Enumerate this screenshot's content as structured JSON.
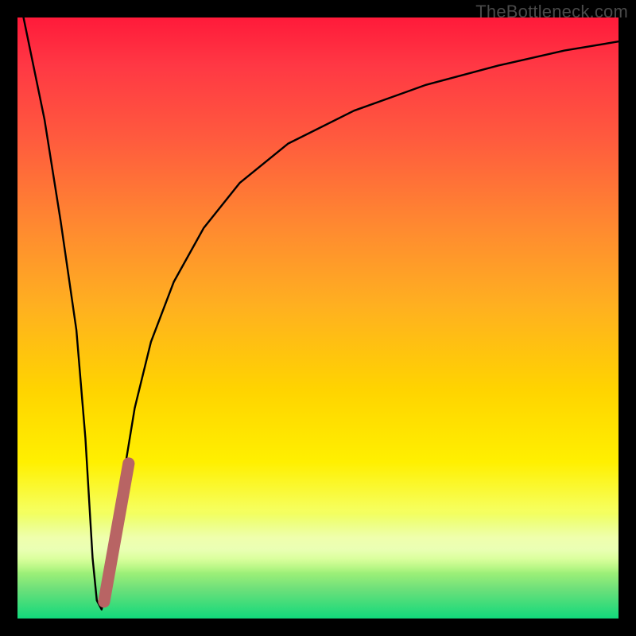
{
  "credit_text": "TheBottleneck.com",
  "colors": {
    "background": "#000000",
    "curve": "#000000",
    "accent": "#b86464",
    "credit": "#4a4a4a",
    "gradient_top": "#ff1a3a",
    "gradient_bottom": "#11d97b"
  },
  "chart_data": {
    "type": "line",
    "title": "",
    "xlabel": "",
    "ylabel": "",
    "xlim": [
      0,
      100
    ],
    "ylim": [
      0,
      100
    ],
    "grid": false,
    "legend": false,
    "annotations": [
      "TheBottleneck.com"
    ],
    "series": [
      {
        "name": "bottleneck-curve",
        "color": "#000000",
        "x": [
          0,
          2,
          4,
          6,
          8,
          10,
          11.5,
          13,
          15,
          17,
          19,
          21,
          24,
          28,
          33,
          40,
          50,
          62,
          75,
          88,
          100
        ],
        "y": [
          100,
          87,
          74,
          60,
          46,
          30,
          10,
          1,
          6,
          20,
          36,
          48,
          60,
          70,
          78,
          84,
          88.5,
          91.5,
          94,
          96,
          97
        ]
      },
      {
        "name": "accent-segment",
        "color": "#b86464",
        "x": [
          13.5,
          17.5
        ],
        "y": [
          2,
          25
        ]
      }
    ]
  }
}
